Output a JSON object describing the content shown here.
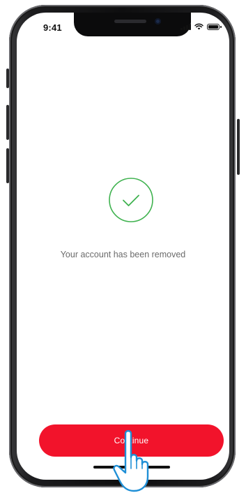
{
  "status_bar": {
    "time": "9:41",
    "icons": [
      "signal-icon",
      "wifi-icon",
      "battery-icon"
    ]
  },
  "content": {
    "icon": "checkmark-circle-icon",
    "message": "Your account has been removed"
  },
  "actions": {
    "continue_label": "Continue"
  },
  "colors": {
    "accent": "#f2132b",
    "success": "#3fb24f",
    "message_text": "#6b6b6b"
  },
  "overlay": {
    "cursor_icon": "pointing-hand-icon"
  }
}
